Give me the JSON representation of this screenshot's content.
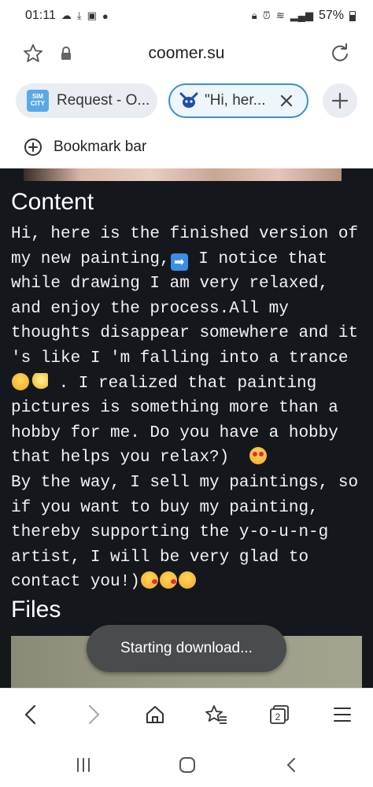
{
  "status_bar": {
    "time": "01:11",
    "battery": "57%",
    "left_icons": [
      "weather-icon",
      "download-icon",
      "image-icon",
      "chat-icon"
    ],
    "right_icons": [
      "lock-icon",
      "alarm-icon",
      "wifi-icon",
      "signal-icon",
      "battery-icon"
    ]
  },
  "address_bar": {
    "url": "coomer.su"
  },
  "tabs": [
    {
      "label": "Request - O...",
      "favicon": "simcity-icon",
      "favicon_text": "SIM CITY",
      "active": false
    },
    {
      "label": "\"Hi, her...",
      "favicon": "devil-icon",
      "active": true
    }
  ],
  "bookmark_bar": {
    "label": "Bookmark bar"
  },
  "content": {
    "heading": "Content",
    "lines": [
      {
        "text": "Hi, here is the finished version of"
      },
      {
        "text": "my new painting,",
        "emoji_after": "arrow-right",
        "rest": " I notice that"
      },
      {
        "text": "while drawing I am very relaxed,"
      },
      {
        "text": "and enjoy the process.All my"
      },
      {
        "text": "thoughts disappear somewhere and it"
      },
      {
        "text": "'s like I 'm falling into a trance"
      },
      {
        "text": " . I realized that painting",
        "emoji_before": [
          "relieved",
          "dizzy"
        ]
      },
      {
        "text": "pictures is something more than a"
      },
      {
        "text": "hobby for me. Do you have a hobby"
      },
      {
        "text": "that helps you relax?)  ",
        "emoji_after_list": [
          "heart-eyes"
        ]
      },
      {
        "text": "By the way, I sell my paintings, so"
      },
      {
        "text": "if you want to buy my painting,"
      },
      {
        "text": "thereby supporting the y-o-u-n-g"
      },
      {
        "text": "artist, I will be very glad to"
      },
      {
        "text": "contact you!)",
        "emoji_after_list": [
          "kiss",
          "kiss",
          "relieved"
        ]
      }
    ],
    "files_heading": "Files"
  },
  "toast": {
    "message": "Starting download..."
  },
  "toolbar": {
    "tabs_count": "2"
  },
  "colors": {
    "page_bg": "#14181c",
    "active_tab_border": "#3a8fd0",
    "toast_bg": "#4a4b4d"
  }
}
